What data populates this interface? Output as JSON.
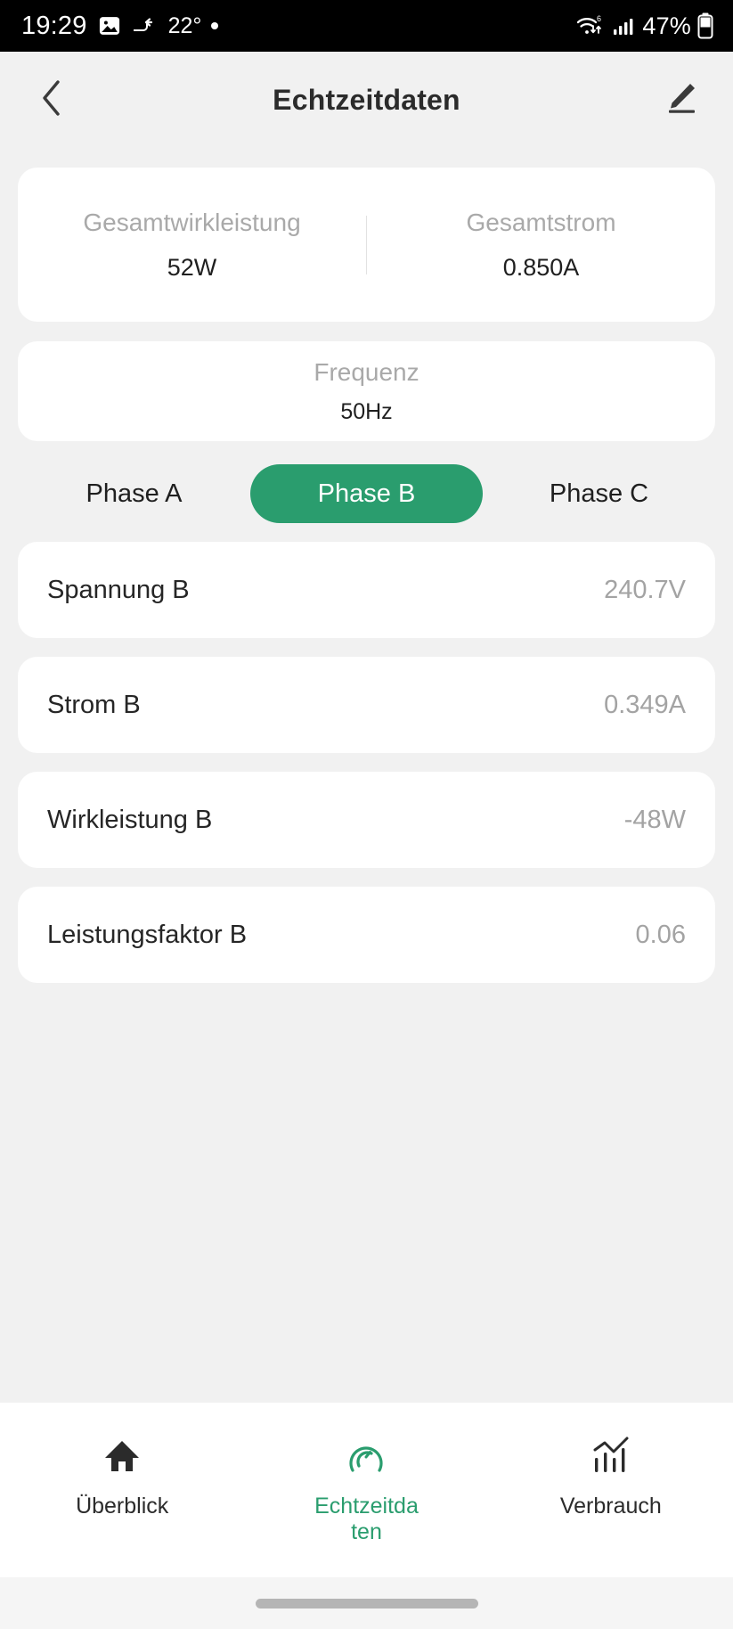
{
  "status_bar": {
    "time": "19:29",
    "temperature": "22°",
    "battery_percent": "47%",
    "icons": [
      "image-icon",
      "arrow-redirect-icon",
      "dot-icon",
      "wifi6-data-icon",
      "cellular-signal-icon",
      "battery-icon"
    ]
  },
  "header": {
    "back_icon": "chevron-left-icon",
    "title": "Echtzeitdaten",
    "edit_icon": "pencil-edit-icon"
  },
  "summary": {
    "total_power_label": "Gesamtwirkleistung",
    "total_power_value": "52W",
    "total_current_label": "Gesamtstrom",
    "total_current_value": "0.850A"
  },
  "frequency": {
    "label": "Frequenz",
    "value": "50Hz"
  },
  "phase_tabs": {
    "items": [
      {
        "label": "Phase A",
        "active": false
      },
      {
        "label": "Phase B",
        "active": true
      },
      {
        "label": "Phase C",
        "active": false
      }
    ]
  },
  "measurements": [
    {
      "label": "Spannung B",
      "value": "240.7V"
    },
    {
      "label": "Strom B",
      "value": "0.349A"
    },
    {
      "label": "Wirkleistung B",
      "value": "-48W"
    },
    {
      "label": "Leistungsfaktor B",
      "value": "0.06"
    }
  ],
  "bottom_nav": [
    {
      "label": "Überblick",
      "icon": "home-icon",
      "active": false
    },
    {
      "label": "Echtzeitdaten",
      "icon": "gauge-icon",
      "active": true
    },
    {
      "label": "Verbrauch",
      "icon": "bar-chart-icon",
      "active": false
    }
  ],
  "colors": {
    "accent_green": "#2a9d6e",
    "page_background": "#f1f1f1",
    "card_background": "#ffffff",
    "muted_text": "#a9a9a9",
    "primary_text": "#262626"
  }
}
